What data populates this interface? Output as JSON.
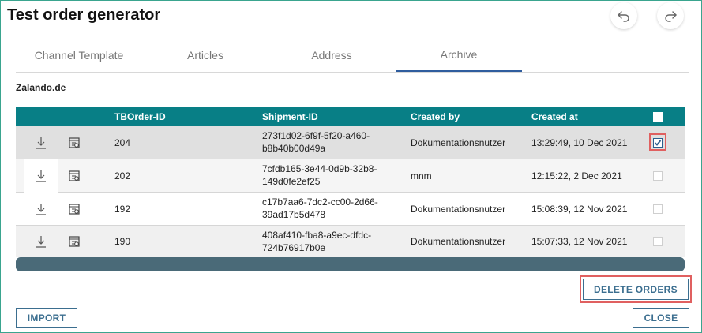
{
  "window": {
    "title": "Test order generator"
  },
  "tabs": [
    {
      "label": "Channel Template",
      "active": false
    },
    {
      "label": "Articles",
      "active": false
    },
    {
      "label": "Address",
      "active": false
    },
    {
      "label": "Archive",
      "active": true
    }
  ],
  "store": "Zalando.de",
  "table": {
    "columns": [
      "TBOrder-ID",
      "Shipment-ID",
      "Created by",
      "Created at"
    ],
    "rows": [
      {
        "order_id": "204",
        "shipment_line1": "273f1d02-6f9f-5f20-a460-",
        "shipment_line2": "b8b40b00d49a",
        "created_by": "Dokumentationsnutzer",
        "created_at": "13:29:49, 10 Dec 2021",
        "checked": true
      },
      {
        "order_id": "202",
        "shipment_line1": "7cfdb165-3e44-0d9b-32b8-",
        "shipment_line2": "149d0fe2ef25",
        "created_by": "mnm",
        "created_at": "12:15:22, 2 Dec 2021",
        "checked": false
      },
      {
        "order_id": "192",
        "shipment_line1": "c17b7aa6-7dc2-cc00-2d66-",
        "shipment_line2": "39ad17b5d478",
        "created_by": "Dokumentationsnutzer",
        "created_at": "15:08:39, 12 Nov 2021",
        "checked": false
      },
      {
        "order_id": "190",
        "shipment_line1": "408af410-fba8-a9ec-dfdc-",
        "shipment_line2": "724b76917b0e",
        "created_by": "Dokumentationsnutzer",
        "created_at": "15:07:33, 12 Nov 2021",
        "checked": false
      }
    ]
  },
  "buttons": {
    "delete_orders": "DELETE ORDERS",
    "import": "IMPORT",
    "close": "CLOSE"
  },
  "icons": {
    "undo": "undo-icon",
    "redo": "redo-icon",
    "download": "download-icon",
    "document": "document-icon"
  },
  "colors": {
    "header_bg": "#087f86",
    "scrollbar": "#4a6a78",
    "accent": "#3b6e8f",
    "highlight": "#e06060"
  }
}
